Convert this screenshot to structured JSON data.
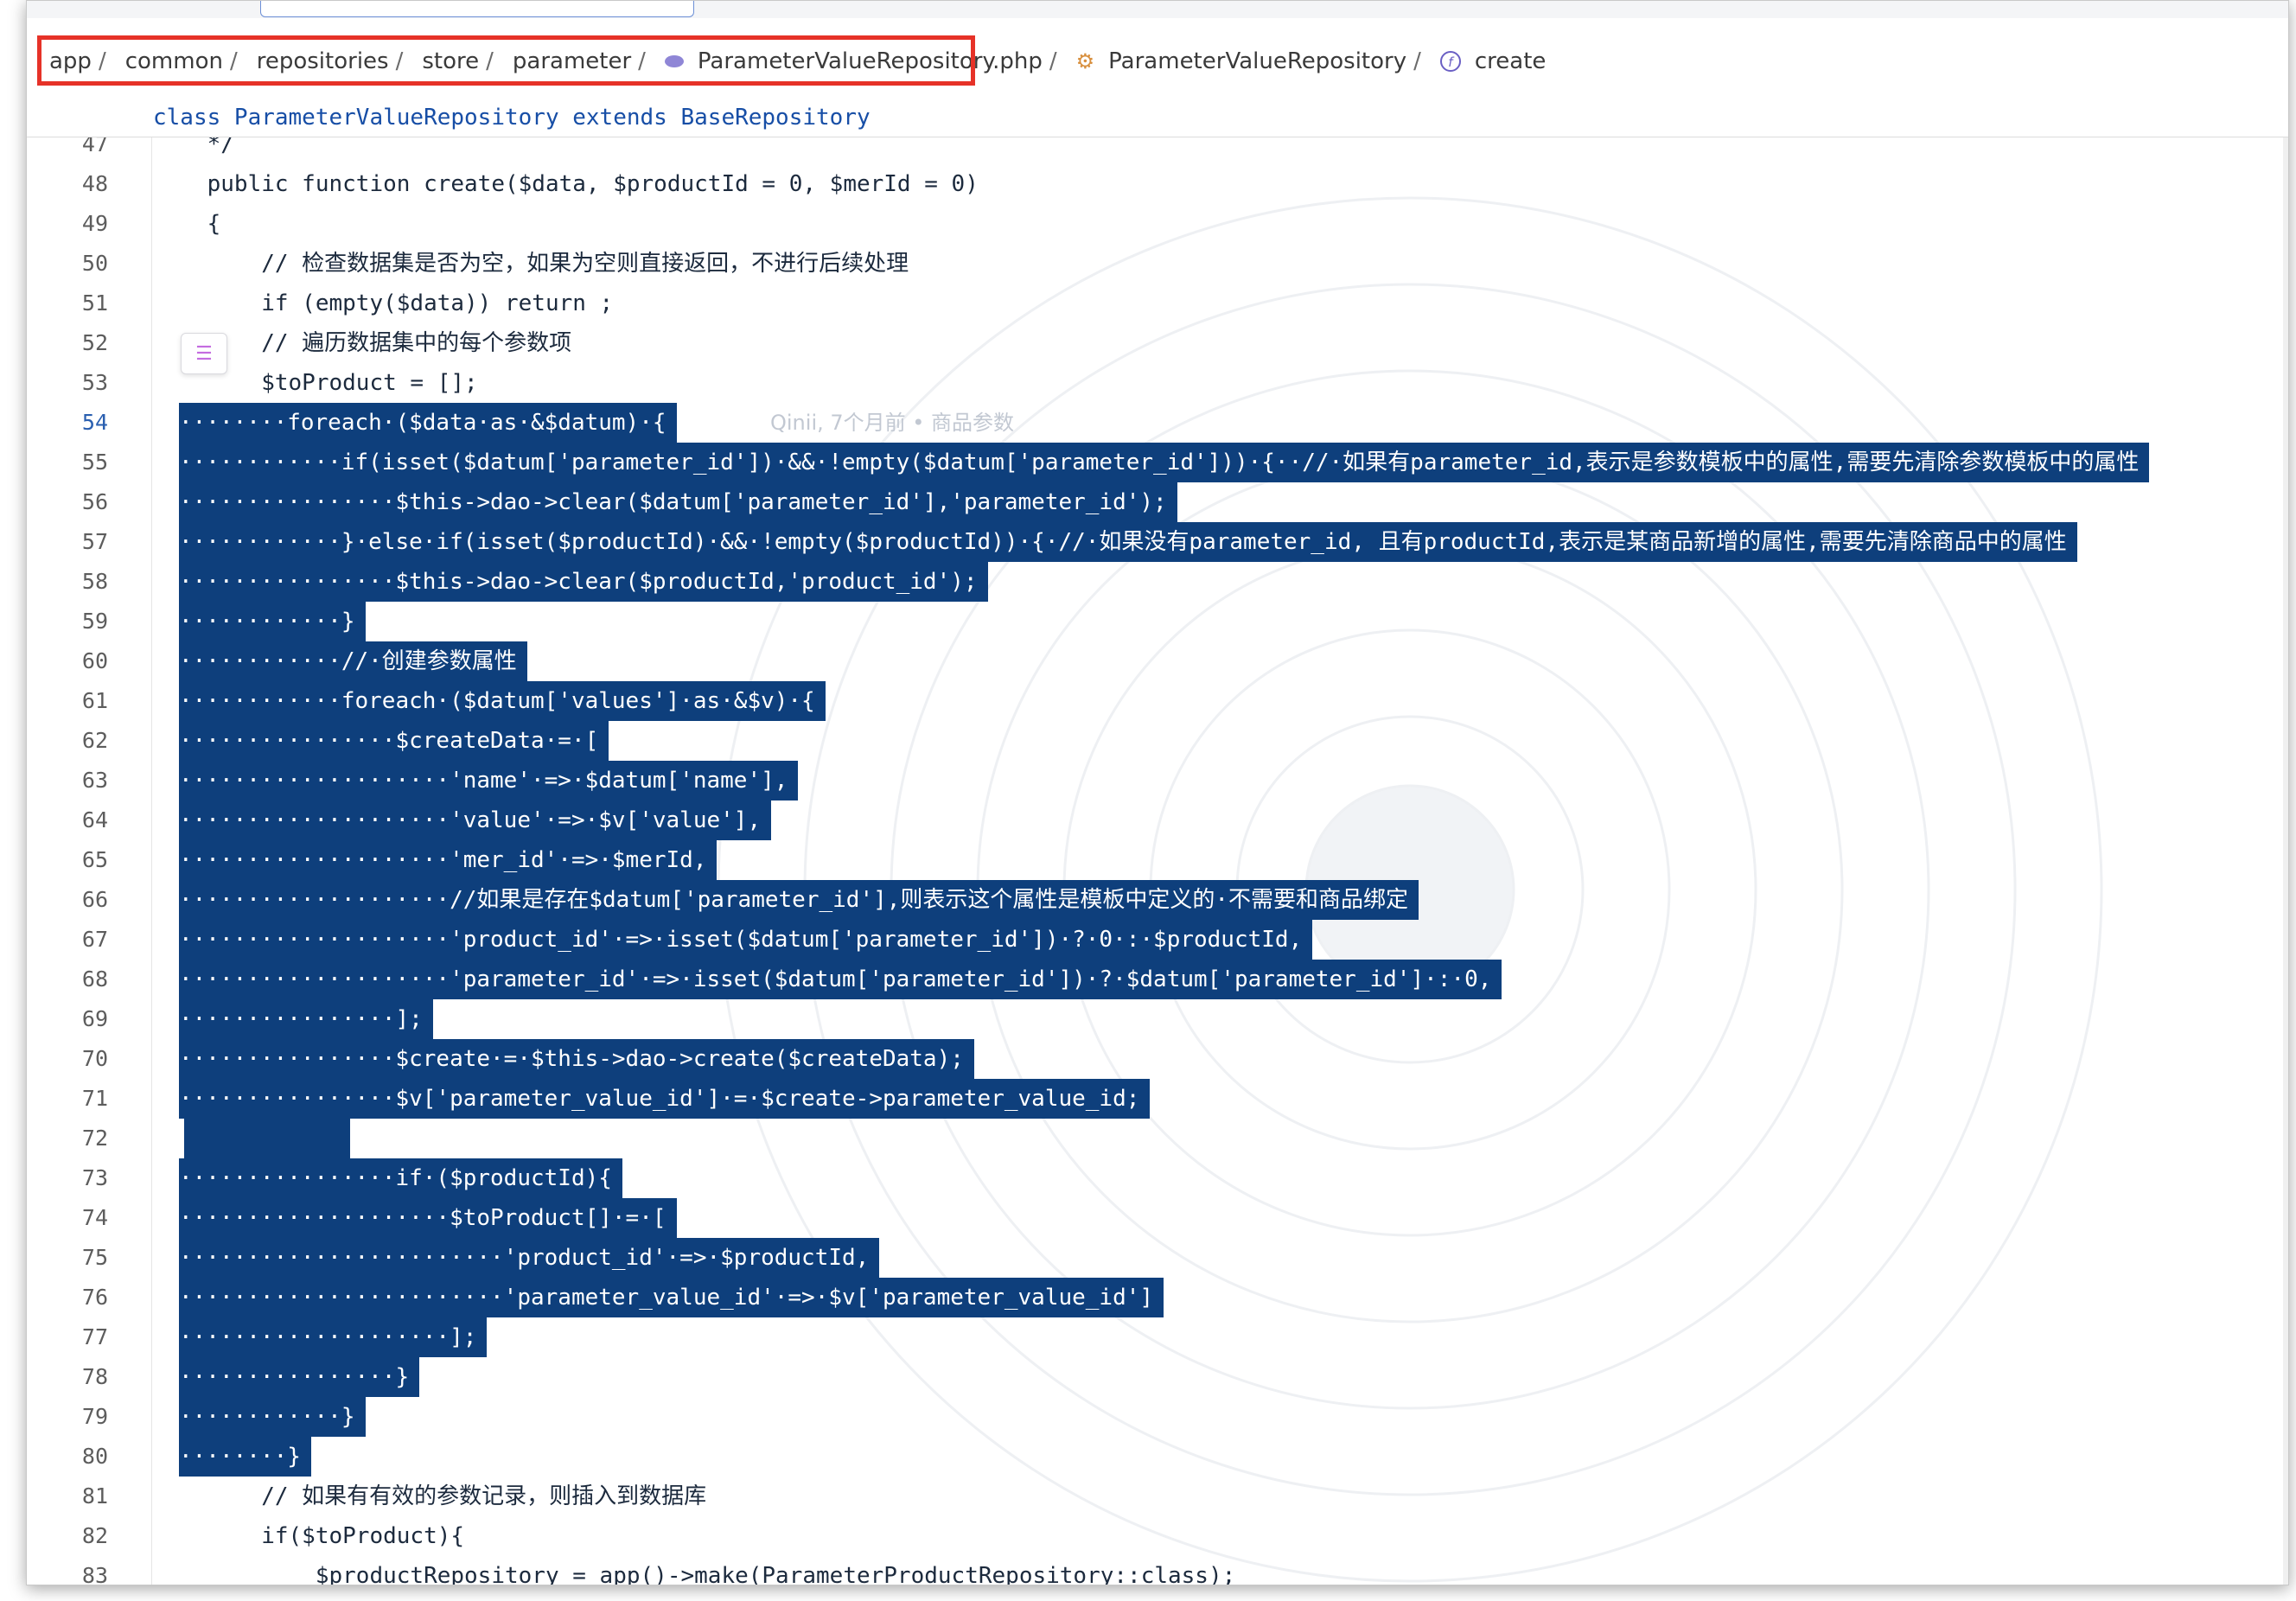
{
  "top_tab": {
    "label": "ParameterValueRepository.php"
  },
  "breadcrumb": {
    "items": [
      "app",
      "common",
      "repositories",
      "store",
      "parameter",
      "ParameterValueRepository.php",
      "ParameterValueRepository",
      "create"
    ],
    "separator": "/"
  },
  "sticky_header": {
    "text": "class ParameterValueRepository extends BaseRepository"
  },
  "inlay_hint": {
    "text": "Qinii, 7个月前 • 商品参数"
  },
  "colors": {
    "selection": "#0e3f7c",
    "highlight_box": "#e63228",
    "line_number_current": "#2a5fb0"
  },
  "current_line": "54",
  "lines": [
    {
      "n": "47",
      "text": "    */"
    },
    {
      "n": "48",
      "text": "    public function create($data, $productId = 0, $merId = 0)"
    },
    {
      "n": "49",
      "text": "    {"
    },
    {
      "n": "50",
      "text": "        // 检查数据集是否为空，如果为空则直接返回，不进行后续处理"
    },
    {
      "n": "51",
      "text": "        if (empty($data)) return ;"
    },
    {
      "n": "52",
      "text": "        // 遍历数据集中的每个参数项"
    },
    {
      "n": "53",
      "text": "        $toProduct = [];"
    },
    {
      "n": "54",
      "text": "········foreach·($data·as·&$datum)·{"
    },
    {
      "n": "55",
      "text": "············if(isset($datum['parameter_id'])·&&·!empty($datum['parameter_id']))·{··//·如果有parameter_id,表示是参数模板中的属性,需要先清除参数模板中的属性"
    },
    {
      "n": "56",
      "text": "················$this->dao->clear($datum['parameter_id'],'parameter_id');"
    },
    {
      "n": "57",
      "text": "············}·else·if(isset($productId)·&&·!empty($productId))·{·//·如果没有parameter_id, 且有productId,表示是某商品新增的属性,需要先清除商品中的属性"
    },
    {
      "n": "58",
      "text": "················$this->dao->clear($productId,'product_id');"
    },
    {
      "n": "59",
      "text": "············}"
    },
    {
      "n": "60",
      "text": "············//·创建参数属性"
    },
    {
      "n": "61",
      "text": "············foreach·($datum['values']·as·&$v)·{"
    },
    {
      "n": "62",
      "text": "················$createData·=·["
    },
    {
      "n": "63",
      "text": "····················'name'·=>·$datum['name'],"
    },
    {
      "n": "64",
      "text": "····················'value'·=>·$v['value'],"
    },
    {
      "n": "65",
      "text": "····················'mer_id'·=>·$merId,"
    },
    {
      "n": "66",
      "text": "····················//如果是存在$datum['parameter_id'],则表示这个属性是模板中定义的·不需要和商品绑定"
    },
    {
      "n": "67",
      "text": "····················'product_id'·=>·isset($datum['parameter_id'])·?·0·:·$productId,"
    },
    {
      "n": "68",
      "text": "····················'parameter_id'·=>·isset($datum['parameter_id'])·?·$datum['parameter_id']·:·0,"
    },
    {
      "n": "69",
      "text": "················];"
    },
    {
      "n": "70",
      "text": "················$create·=·$this->dao->create($createData);"
    },
    {
      "n": "71",
      "text": "················$v['parameter_value_id']·=·$create->parameter_value_id;"
    },
    {
      "n": "72",
      "text": ""
    },
    {
      "n": "73",
      "text": "················if·($productId){"
    },
    {
      "n": "74",
      "text": "····················$toProduct[]·=·["
    },
    {
      "n": "75",
      "text": "························'product_id'·=>·$productId,"
    },
    {
      "n": "76",
      "text": "························'parameter_value_id'·=>·$v['parameter_value_id']"
    },
    {
      "n": "77",
      "text": "····················];"
    },
    {
      "n": "78",
      "text": "················}"
    },
    {
      "n": "79",
      "text": "············}"
    },
    {
      "n": "80",
      "text": "········}"
    },
    {
      "n": "81",
      "text": "        // 如果有有效的参数记录，则插入到数据库"
    },
    {
      "n": "82",
      "text": "        if($toProduct){"
    },
    {
      "n": "83",
      "text": "            $productRepository = app()->make(ParameterProductRepository::class);"
    }
  ]
}
